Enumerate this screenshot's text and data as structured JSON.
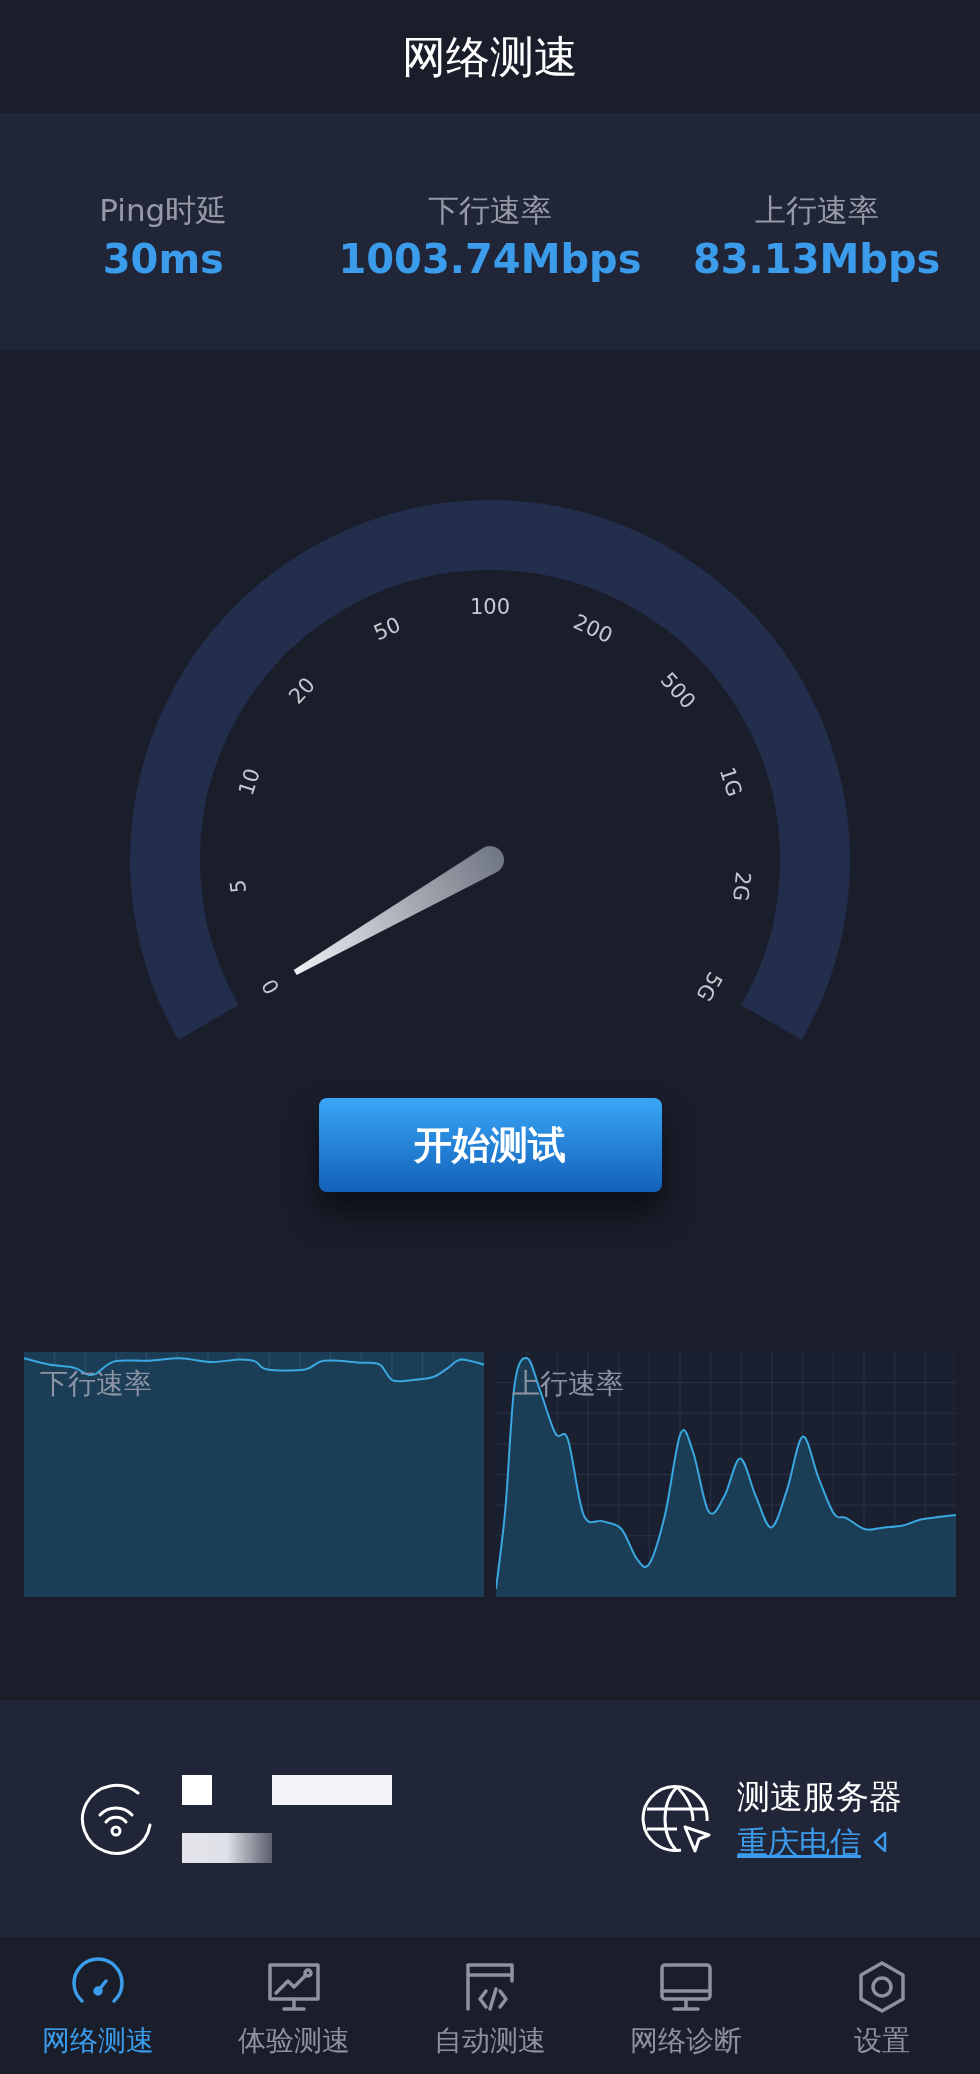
{
  "header": {
    "title": "网络测速"
  },
  "stats": [
    {
      "label": "Ping时延",
      "value": "30ms"
    },
    {
      "label": "下行速率",
      "value": "1003.74Mbps"
    },
    {
      "label": "上行速率",
      "value": "83.13Mbps"
    }
  ],
  "gauge": {
    "scale": [
      "0",
      "5",
      "10",
      "20",
      "50",
      "100",
      "200",
      "500",
      "1G",
      "2G",
      "5G"
    ]
  },
  "start_button": {
    "label": "开始测试"
  },
  "graphs": [
    {
      "label": "下行速率"
    },
    {
      "label": "上行速率"
    }
  ],
  "server": {
    "title": "测速服务器",
    "name": "重庆电信"
  },
  "nav": [
    {
      "label": "网络测速",
      "selected": true
    },
    {
      "label": "体验测速",
      "selected": false
    },
    {
      "label": "自动测速",
      "selected": false
    },
    {
      "label": "网络诊断",
      "selected": false
    },
    {
      "label": "设置",
      "selected": false
    }
  ]
}
